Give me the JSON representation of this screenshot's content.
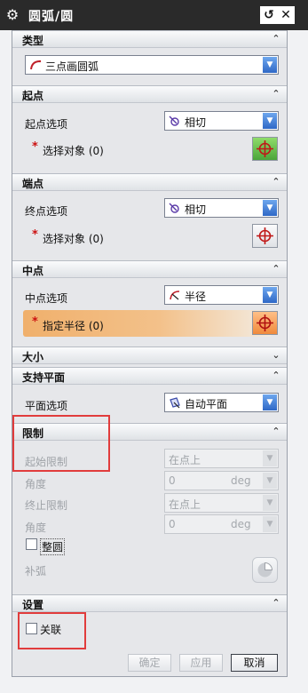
{
  "window": {
    "title": "圆弧/圆"
  },
  "sections": {
    "type": {
      "label": "类型",
      "combo_value": "三点画圆弧"
    },
    "start": {
      "label": "起点",
      "option_label": "起点选项",
      "option_value": "相切",
      "select_label": "选择对象 (0)"
    },
    "end": {
      "label": "端点",
      "option_label": "终点选项",
      "option_value": "相切",
      "select_label": "选择对象 (0)"
    },
    "mid": {
      "label": "中点",
      "option_label": "中点选项",
      "option_value": "半径",
      "select_label": "指定半径 (0)"
    },
    "size": {
      "label": "大小"
    },
    "plane": {
      "label": "支持平面",
      "option_label": "平面选项",
      "option_value": "自动平面"
    },
    "limits": {
      "label": "限制",
      "start_limit_label": "起始限制",
      "start_limit_value": "在点上",
      "angle1_label": "角度",
      "angle1_value": "0",
      "angle1_unit": "deg",
      "end_limit_label": "终止限制",
      "end_limit_value": "在点上",
      "angle2_label": "角度",
      "angle2_value": "0",
      "angle2_unit": "deg",
      "full_circle_label": "整圆",
      "complement_label": "补弧"
    },
    "settings": {
      "label": "设置",
      "associative_label": "关联"
    }
  },
  "buttons": {
    "ok": "确定",
    "apply": "应用",
    "cancel": "取消"
  }
}
